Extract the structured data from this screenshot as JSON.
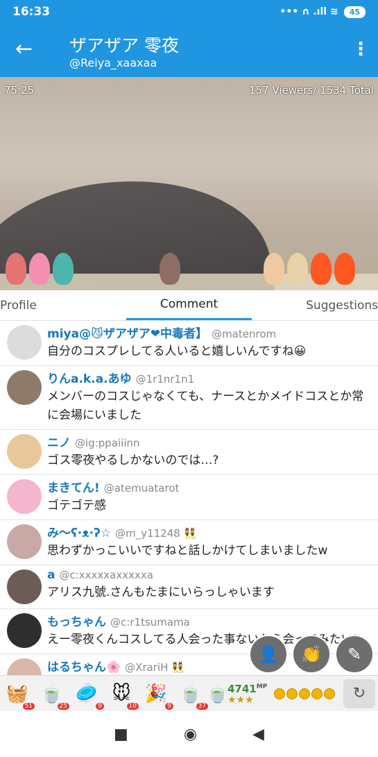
{
  "status": {
    "time": "16:33",
    "indicators": "••• ∩ .ıll ≋",
    "battery": "45"
  },
  "header": {
    "title": "ザアザア 零夜",
    "handle": "@Reiya_xaaxaa"
  },
  "video": {
    "elapsed": "75:25",
    "viewers": "157 Viewers/ 1534 Total"
  },
  "tabs": [
    {
      "label": "Profile",
      "active": false
    },
    {
      "label": "Comment",
      "active": true
    },
    {
      "label": "Suggestions",
      "active": false
    }
  ],
  "comments": [
    {
      "name": "miya@😼ザアザア❤中毒者】",
      "handle": "@matenrom",
      "text": "自分のコスプレしてる人いると嬉しいんですね😀",
      "avatar_color": "#dcdcdc"
    },
    {
      "name": "りんa.k.a.あゆ",
      "handle": "@1r1nr1n1",
      "text": "メンバーのコスじゃなくても、ナースとかメイドコスとか常に会場にいました",
      "avatar_color": "#8d7a68"
    },
    {
      "name": "ニノ",
      "handle": "@ig:ppaiiinn",
      "text": "ゴス零夜やるしかないのでは…?",
      "avatar_color": "#e8c89a"
    },
    {
      "name": "まきてん!",
      "handle": "@atemuatarot",
      "text": "ゴテゴテ感",
      "avatar_color": "#f4b6cf"
    },
    {
      "name": "み〜ʕ·ᴥ·ʔ☆",
      "handle": "@m_y11248 👯",
      "text": "思わずかっこいいですねと話しかけてしまいましたw",
      "avatar_color": "#c9a9a6"
    },
    {
      "name": "a",
      "handle": "@c:xxxxxaxxxxxa",
      "text": "アリス九號.さんもたまにいらっしゃいます",
      "avatar_color": "#6b5d55"
    },
    {
      "name": "もっちゃん",
      "handle": "@c:r1tsumama",
      "text": "えー零夜くんコスしてる人会った事ないから会ってみたい!",
      "avatar_color": "#2e2e2e"
    },
    {
      "name": "はるちゃん🌸",
      "handle": "@XrariH 👯",
      "text": "",
      "avatar_color": "#d9b8a8"
    }
  ],
  "gifts": [
    {
      "icon": "🧺",
      "count": "51"
    },
    {
      "icon": "🍵",
      "count": "25"
    },
    {
      "icon": "🥏",
      "count": "9"
    },
    {
      "icon": "🐭",
      "count": "10"
    },
    {
      "icon": "🎉",
      "count": "9"
    },
    {
      "icon": "🍵",
      "count": "37"
    },
    {
      "icon": "🍵",
      "count": ""
    }
  ],
  "mp": {
    "value": "4741",
    "unit": "MP",
    "stars": "★★★"
  },
  "colors": {
    "accent": "#2196e0",
    "name": "#1778b8"
  }
}
